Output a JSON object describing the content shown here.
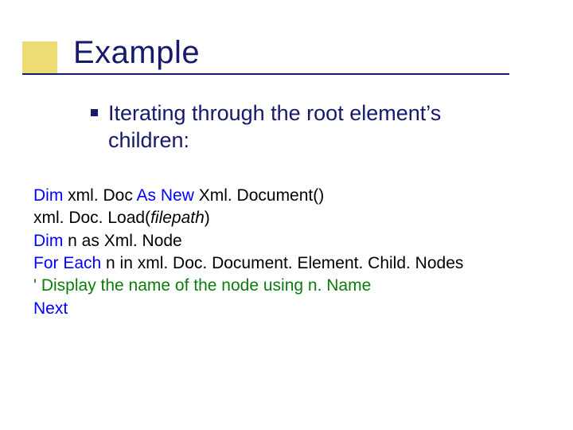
{
  "title": "Example",
  "bullet": "Iterating through the root element’s children:",
  "code": {
    "l1a": "Dim",
    "l1b": " xml. Doc ",
    "l1c": "As New",
    "l1d": " Xml. Document()",
    "l2a": "xml. Doc. Load(",
    "l2b": "filepath",
    "l2c": ")",
    "l3a": "Dim",
    "l3b": " n as Xml. Node",
    "l4a": "For Each",
    "l4b": " n in xml. Doc. Document. Element. Child. Nodes",
    "l5": "  ' Display the name of the node using n. Name",
    "l6": "Next"
  }
}
